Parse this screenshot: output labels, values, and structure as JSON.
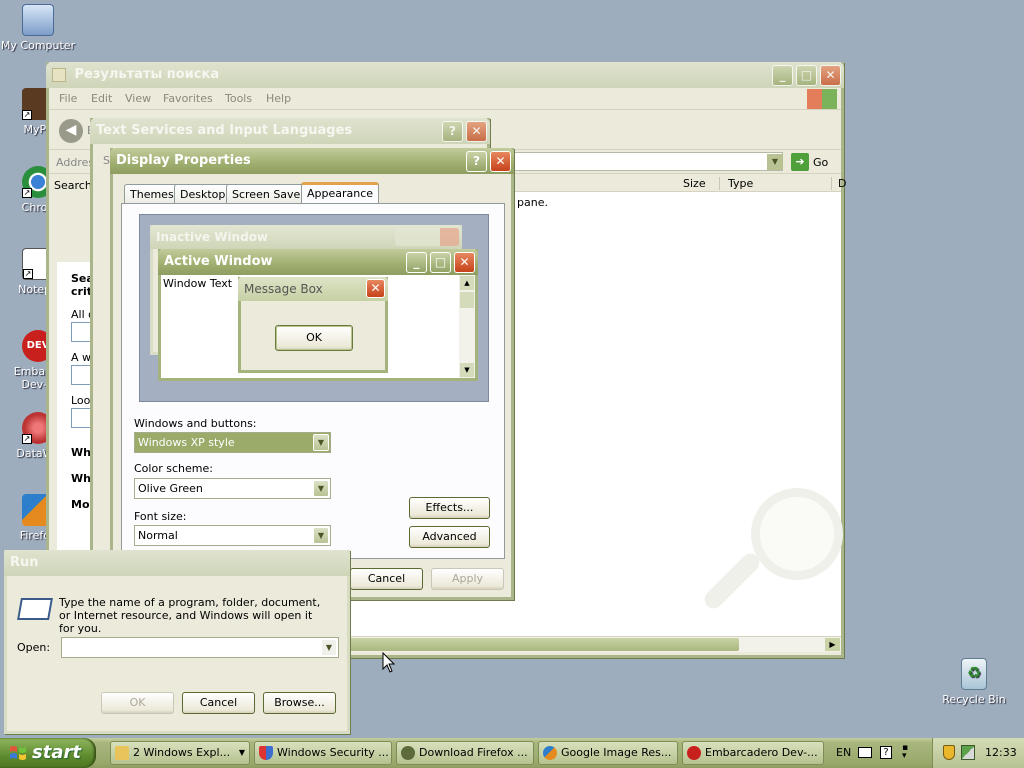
{
  "desktop": {
    "icons": [
      {
        "label": "My Computer",
        "name": "my-computer-icon"
      },
      {
        "label": "MyPa",
        "name": "mypa-icon"
      },
      {
        "label": "Chron",
        "name": "chrome-icon"
      },
      {
        "label": "Notepa",
        "name": "notepad-icon"
      },
      {
        "label": "Embarca",
        "label2": "Dev-C",
        "name": "embarcadero-icon"
      },
      {
        "label": "DataWa",
        "name": "datawa-icon"
      },
      {
        "label": "Firefox",
        "name": "firefox-icon"
      },
      {
        "label": "Recycle Bin",
        "name": "recycle-bin-icon"
      }
    ]
  },
  "search_window": {
    "title": "Результаты поиска",
    "menu": [
      "File",
      "Edit",
      "View",
      "Favorites",
      "Tools",
      "Help"
    ],
    "back_label": "B",
    "address_label": "Addres",
    "go_label": "Go",
    "search_label": "Search",
    "columns": {
      "size": "Size",
      "type": "Type",
      "d": "D"
    },
    "pane_text": "pane.",
    "sidebar": {
      "heading1": "Sea",
      "heading2": "crit",
      "all": "All o",
      "word": "A wo",
      "look": "Look",
      "when": "Whe",
      "what": "Wha",
      "more": "Mor"
    }
  },
  "text_services": {
    "title": "Text Services and Input Languages",
    "fragment": "S"
  },
  "display_properties": {
    "title": "Display Properties",
    "tabs": [
      "Themes",
      "Desktop",
      "Screen Saver",
      "Appearance"
    ],
    "selected_tab": "Appearance",
    "preview": {
      "inactive_title": "Inactive Window",
      "active_title": "Active Window",
      "window_text": "Window Text",
      "msgbox_title": "Message Box",
      "msgbox_ok": "OK"
    },
    "windows_buttons_label": "Windows and buttons:",
    "windows_buttons_value": "Windows XP style",
    "color_scheme_label": "Color scheme:",
    "color_scheme_value": "Olive Green",
    "font_size_label": "Font size:",
    "font_size_value": "Normal",
    "effects_button": "Effects...",
    "advanced_button": "Advanced",
    "ok_button": "OK",
    "cancel_button": "Cancel",
    "apply_button": "Apply"
  },
  "run_dialog": {
    "title": "Run",
    "description": "Type the name of a program, folder, document, or Internet resource, and Windows will open it for you.",
    "open_label": "Open:",
    "open_value": "",
    "ok_button": "OK",
    "cancel_button": "Cancel",
    "browse_button": "Browse..."
  },
  "taskbar": {
    "start_label": "start",
    "tasks": [
      {
        "label": "2 Windows Expl...",
        "name": "task-windows-explorer"
      },
      {
        "label": "Windows Security ...",
        "name": "task-windows-security"
      },
      {
        "label": "Download Firefox ...",
        "name": "task-download-firefox"
      },
      {
        "label": "Google Image Res...",
        "name": "task-google-image"
      },
      {
        "label": "Embarcadero Dev-...",
        "name": "task-embarcadero"
      }
    ],
    "language": "EN",
    "clock": "12:33"
  },
  "colors": {
    "desktop": "#9eadbd",
    "titlebar_olive": "#9fae6f",
    "start_green": "#5f8b2e",
    "close_red": "#c6421a"
  }
}
